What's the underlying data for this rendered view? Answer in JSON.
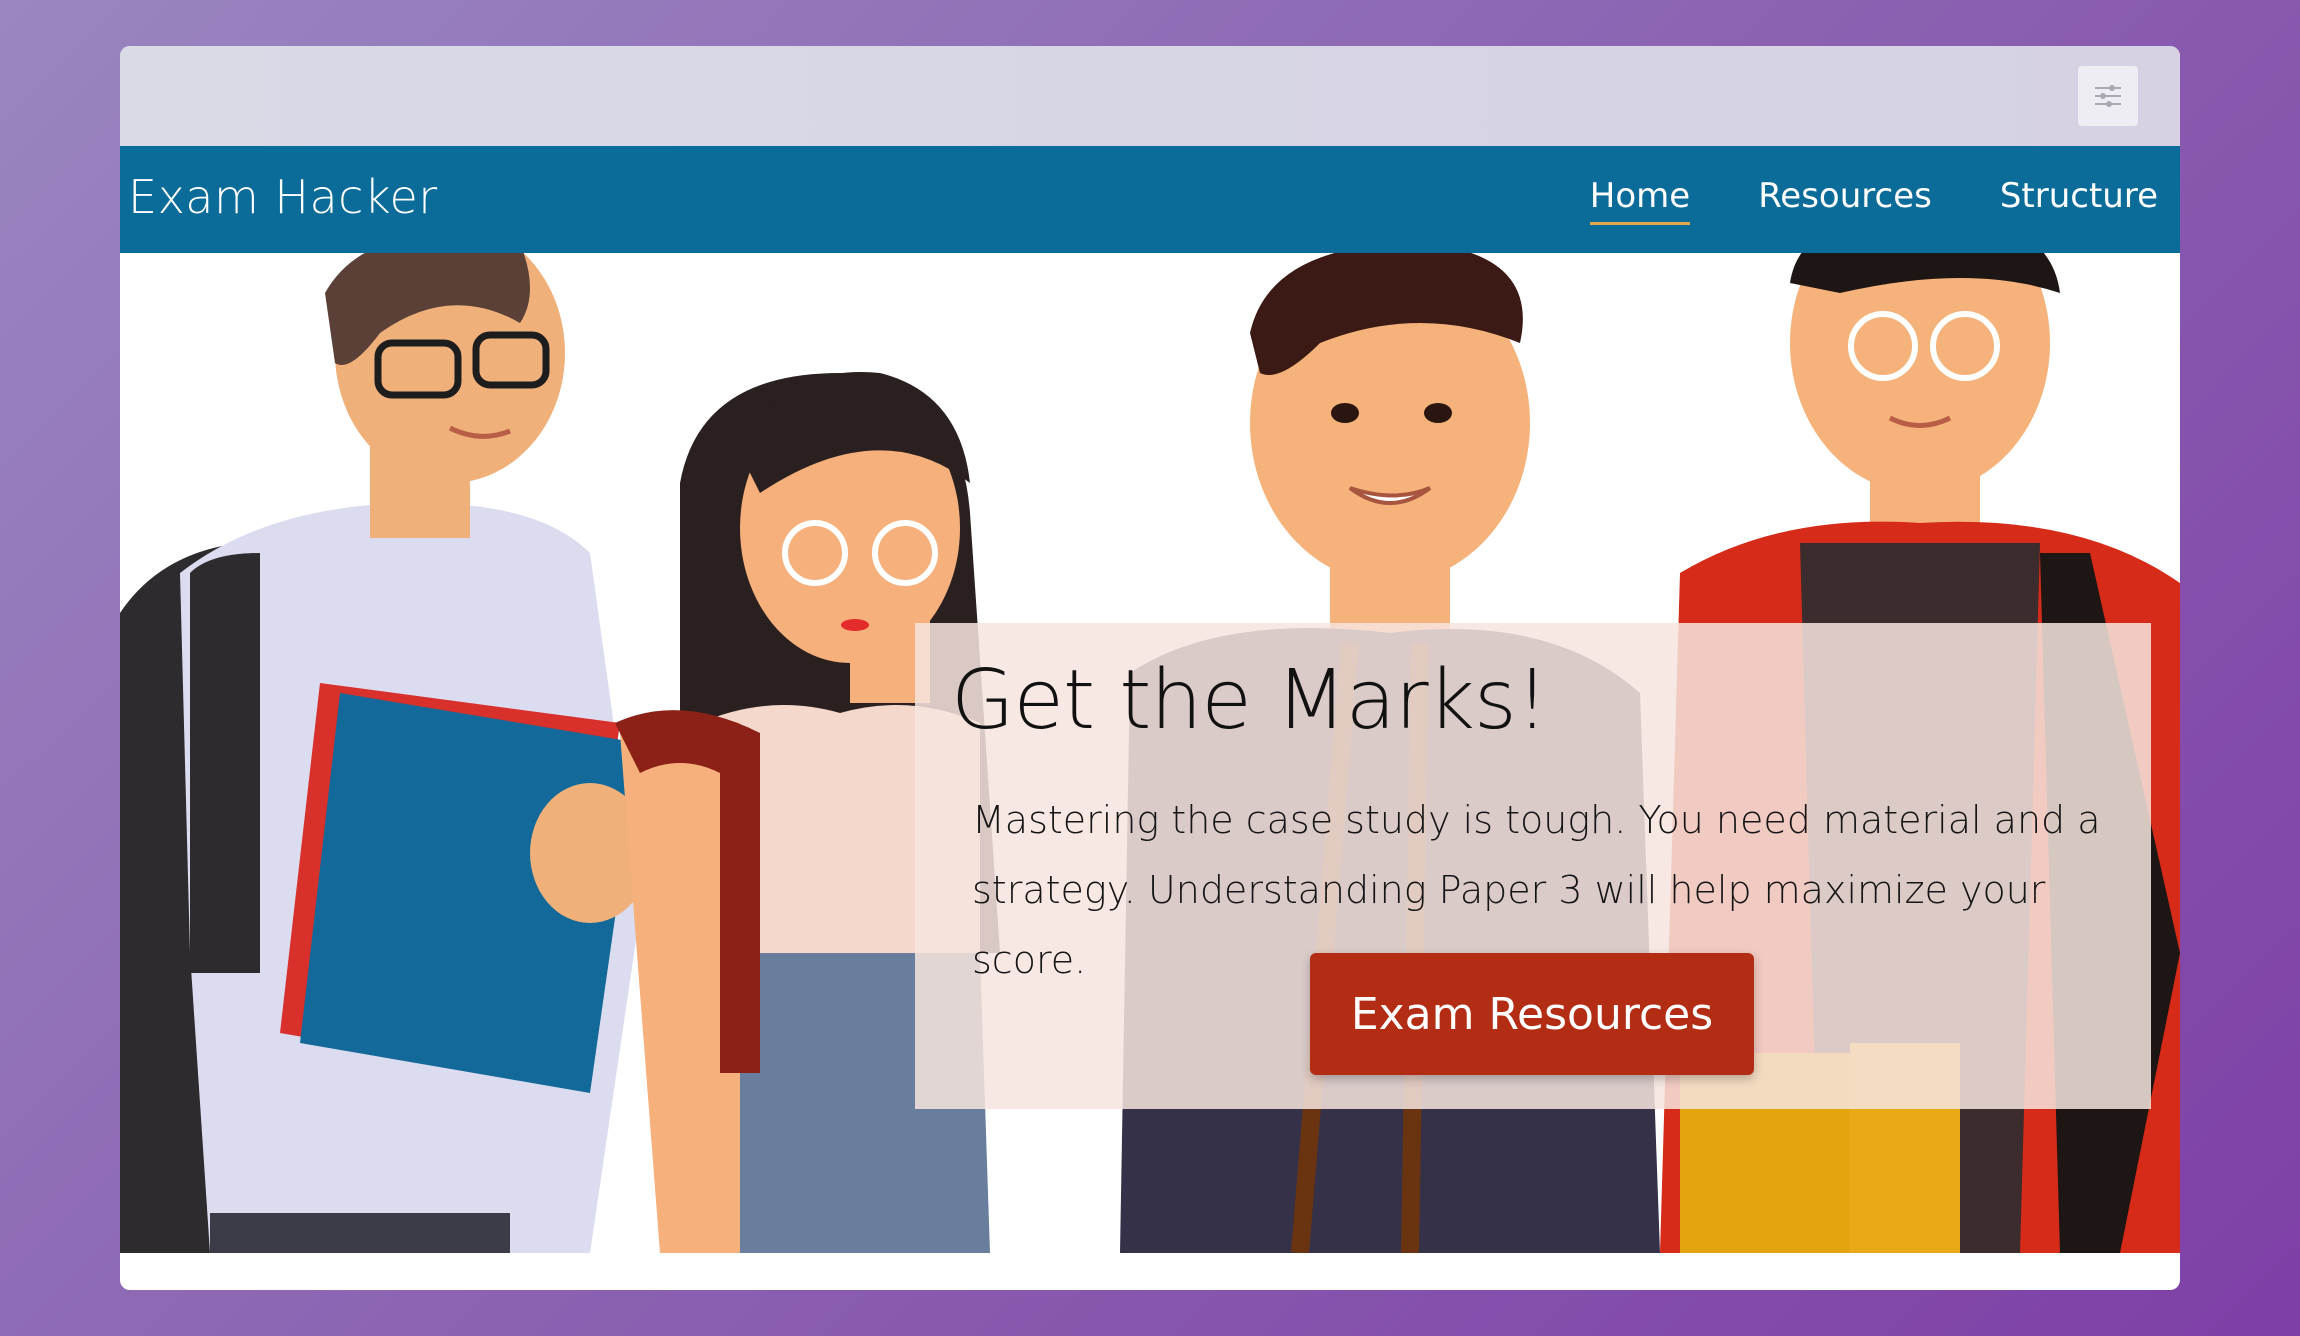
{
  "settings": {
    "icon": "sliders-icon"
  },
  "navbar": {
    "brand": "Exam Hacker",
    "links": [
      {
        "label": "Home",
        "active": true
      },
      {
        "label": "Resources",
        "active": false
      },
      {
        "label": "Structure",
        "active": false
      }
    ]
  },
  "hero": {
    "title": "Get the Marks!",
    "text": "Mastering the case study is tough. You need material and a strategy. Understanding Paper 3 will help maximize your score.",
    "button_label": "Exam Resources"
  },
  "colors": {
    "navbar": "#0b6b99",
    "button": "#b22d14",
    "nav_underline": "#e6a64a",
    "background_start": "#9a86c0",
    "background_end": "#7e3fa6"
  }
}
